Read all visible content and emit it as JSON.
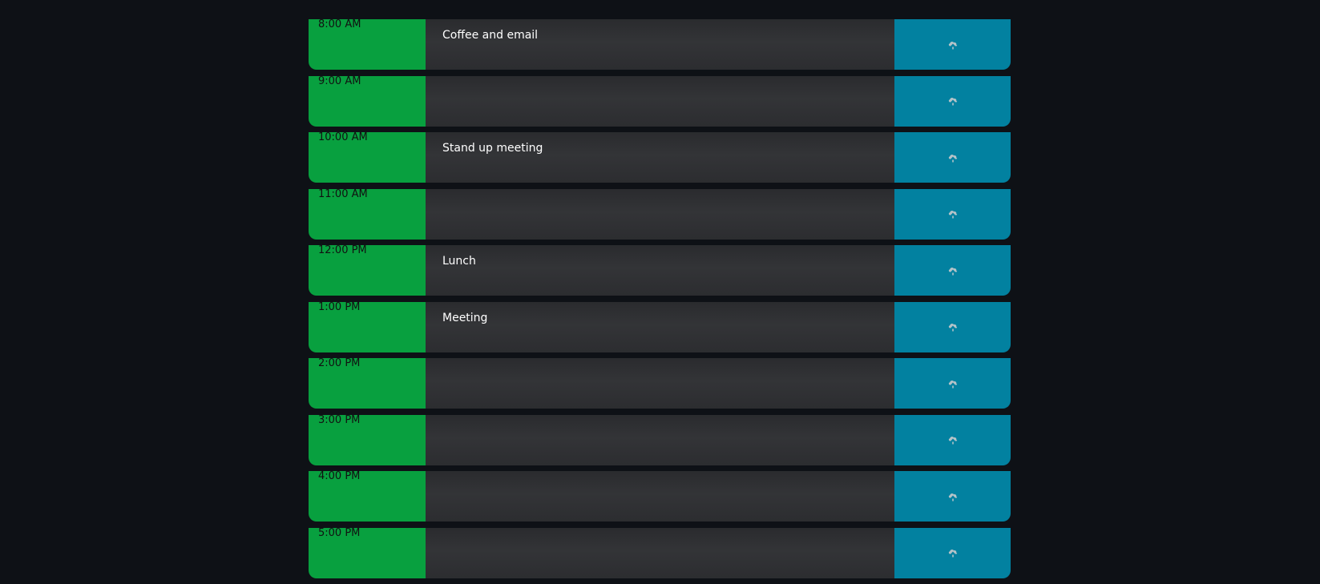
{
  "schedule": {
    "rows": [
      {
        "hour": "8:00 AM",
        "task": "Coffee and email",
        "save_icon": "cloud-upload-icon"
      },
      {
        "hour": "9:00 AM",
        "task": "",
        "save_icon": "cloud-upload-icon"
      },
      {
        "hour": "10:00 AM",
        "task": "Stand up meeting",
        "save_icon": "cloud-upload-icon"
      },
      {
        "hour": "11:00 AM",
        "task": "",
        "save_icon": "cloud-upload-icon"
      },
      {
        "hour": "12:00 PM",
        "task": "Lunch",
        "save_icon": "cloud-upload-icon"
      },
      {
        "hour": "1:00 PM",
        "task": "Meeting",
        "save_icon": "cloud-upload-icon"
      },
      {
        "hour": "2:00 PM",
        "task": "",
        "save_icon": "cloud-upload-icon"
      },
      {
        "hour": "3:00 PM",
        "task": "",
        "save_icon": "cloud-upload-icon"
      },
      {
        "hour": "4:00 PM",
        "task": "",
        "save_icon": "cloud-upload-icon"
      },
      {
        "hour": "5:00 PM",
        "task": "",
        "save_icon": "cloud-upload-icon"
      }
    ]
  },
  "colors": {
    "background": "#0e1116",
    "hour_block": "#08a03f",
    "task_block": "#333437",
    "save_button": "#0281a0",
    "save_icon": "#b5c3c8"
  }
}
